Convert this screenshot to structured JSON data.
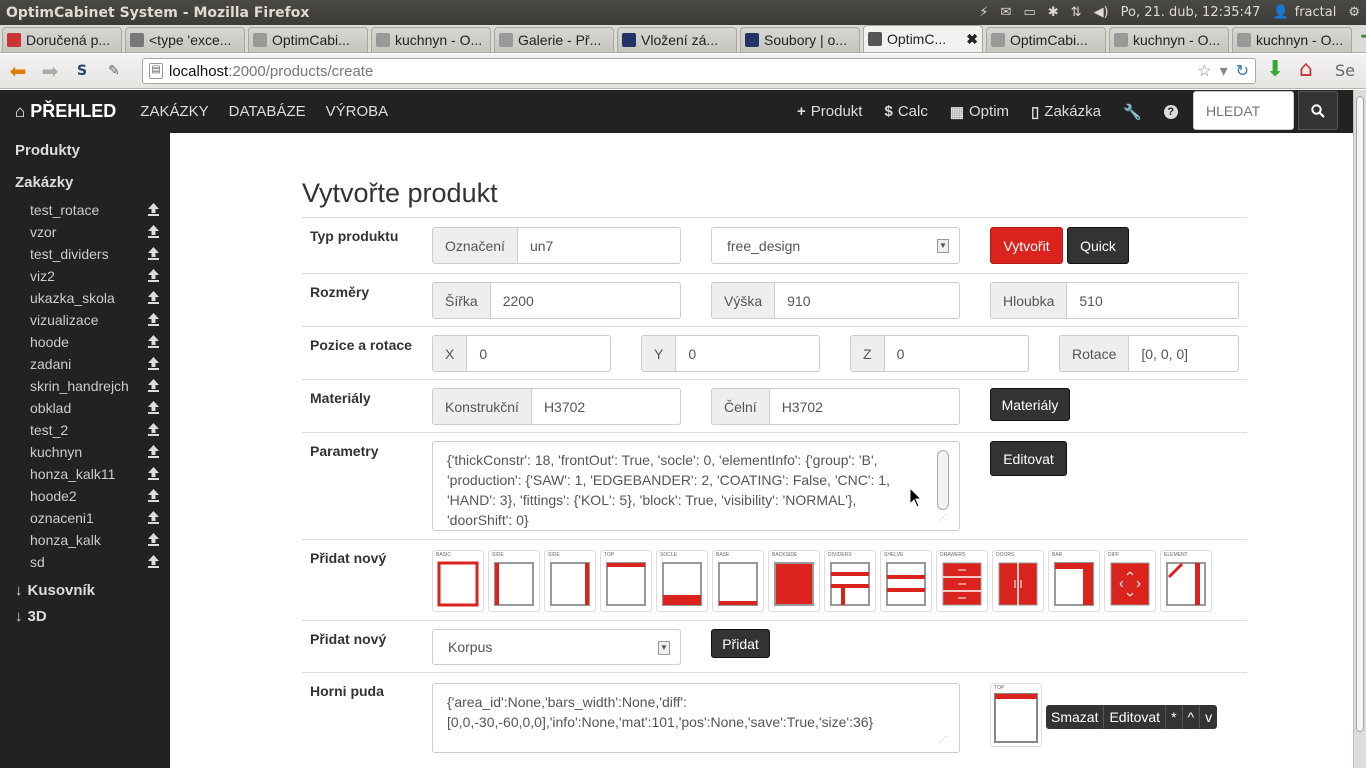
{
  "os": {
    "window_title": "OptimCabinet System - Mozilla Firefox",
    "datetime": "Po, 21. dub, 12:35:47",
    "user": "fractal"
  },
  "tabs": [
    {
      "label": "Doručená p...",
      "color": "#c33"
    },
    {
      "label": "<type 'exce...",
      "color": "#777"
    },
    {
      "label": "OptimCabi...",
      "color": "#999"
    },
    {
      "label": "kuchnyn - O...",
      "color": "#999"
    },
    {
      "label": "Galerie - Př...",
      "color": "#999"
    },
    {
      "label": "Vložení zá...",
      "color": "#236"
    },
    {
      "label": "Soubory | o...",
      "color": "#236"
    },
    {
      "label": "OptimC...",
      "color": "#555"
    },
    {
      "label": "OptimCabi...",
      "color": "#999"
    },
    {
      "label": "kuchnyn - O...",
      "color": "#999"
    },
    {
      "label": "kuchnyn - O...",
      "color": "#999"
    }
  ],
  "url": {
    "host": "localhost",
    "path": ":2000/products/create"
  },
  "appnav": {
    "brand": "PŘEHLED",
    "items": [
      "ZAKÁZKY",
      "DATABÁZE",
      "VÝROBA"
    ],
    "right": [
      {
        "icon": "+",
        "label": "Produkt"
      },
      {
        "icon": "$",
        "label": "Calc"
      },
      {
        "icon": "▦",
        "label": "Optim"
      },
      {
        "icon": "▯",
        "label": "Zakázka"
      }
    ],
    "search_placeholder": "HLEDAT"
  },
  "sidebar": {
    "produkty": "Produkty",
    "zakazky": "Zakázky",
    "items": [
      "test_rotace",
      "vzor",
      "test_dividers",
      "viz2",
      "ukazka_skola",
      "vizualizace",
      "hoode",
      "zadani",
      "skrin_handrejch",
      "obklad",
      "test_2",
      "kuchnyn",
      "honza_kalk11",
      "hoode2",
      "oznaceni1",
      "honza_kalk",
      "sd"
    ],
    "kusovnik": "Kusovník",
    "threed": "3D"
  },
  "form": {
    "title": "Vytvořte produkt",
    "typ": {
      "label": "Typ produktu",
      "oznaceni_label": "Označení",
      "oznaceni_value": "un7",
      "type_select": "free_design",
      "create_btn": "Vytvořit",
      "quick_btn": "Quick"
    },
    "rozmery": {
      "label": "Rozměry",
      "sirka_label": "Šířka",
      "sirka": "2200",
      "vyska_label": "Výška",
      "vyska": "910",
      "hloubka_label": "Hloubka",
      "hloubka": "510"
    },
    "pozice": {
      "label": "Pozice a rotace",
      "x_label": "X",
      "x": "0",
      "y_label": "Y",
      "y": "0",
      "z_label": "Z",
      "z": "0",
      "rot_label": "Rotace",
      "rot": "[0, 0, 0]"
    },
    "materialy": {
      "label": "Materiály",
      "konstr_label": "Konstrukční",
      "konstr": "H3702",
      "celni_label": "Čelní",
      "celni": "H3702",
      "btn": "Materiály"
    },
    "parametry": {
      "label": "Parametry",
      "text": "{'thickConstr': 18, 'frontOut': True, 'socle': 0, 'elementInfo': {'group': 'B', 'production': {'SAW': 1, 'EDGEBANDER': 2, 'COATING': False, 'CNC': 1, 'HAND': 3}, 'fittings': {'KOL': 5}, 'block': True, 'visibility': 'NORMAL'}, 'doorShift': 0}",
      "btn": "Editovat"
    },
    "pridat1": {
      "label": "Přidat nový",
      "elements": [
        "BASIC",
        "SIDE",
        "SIDE",
        "TOP",
        "SOCLE",
        "BASE",
        "BACKSIDE",
        "DIVIDERS",
        "SHELVE",
        "DRAWERS",
        "DOORS",
        "BAR",
        "DIFF",
        "ELEMENT"
      ]
    },
    "pridat2": {
      "label": "Přidat nový",
      "select": "Korpus",
      "btn": "Přidat"
    },
    "horni": {
      "label": "Horni puda",
      "text": "{'area_id':None,'bars_width':None,'diff':[0,0,-30,-60,0,0],'info':None,'mat':101,'pos':None,'save':True,'size':36}",
      "thumb": "TOP",
      "actions": [
        "Smazat",
        "Editovat",
        "*",
        "^",
        "v"
      ]
    }
  }
}
